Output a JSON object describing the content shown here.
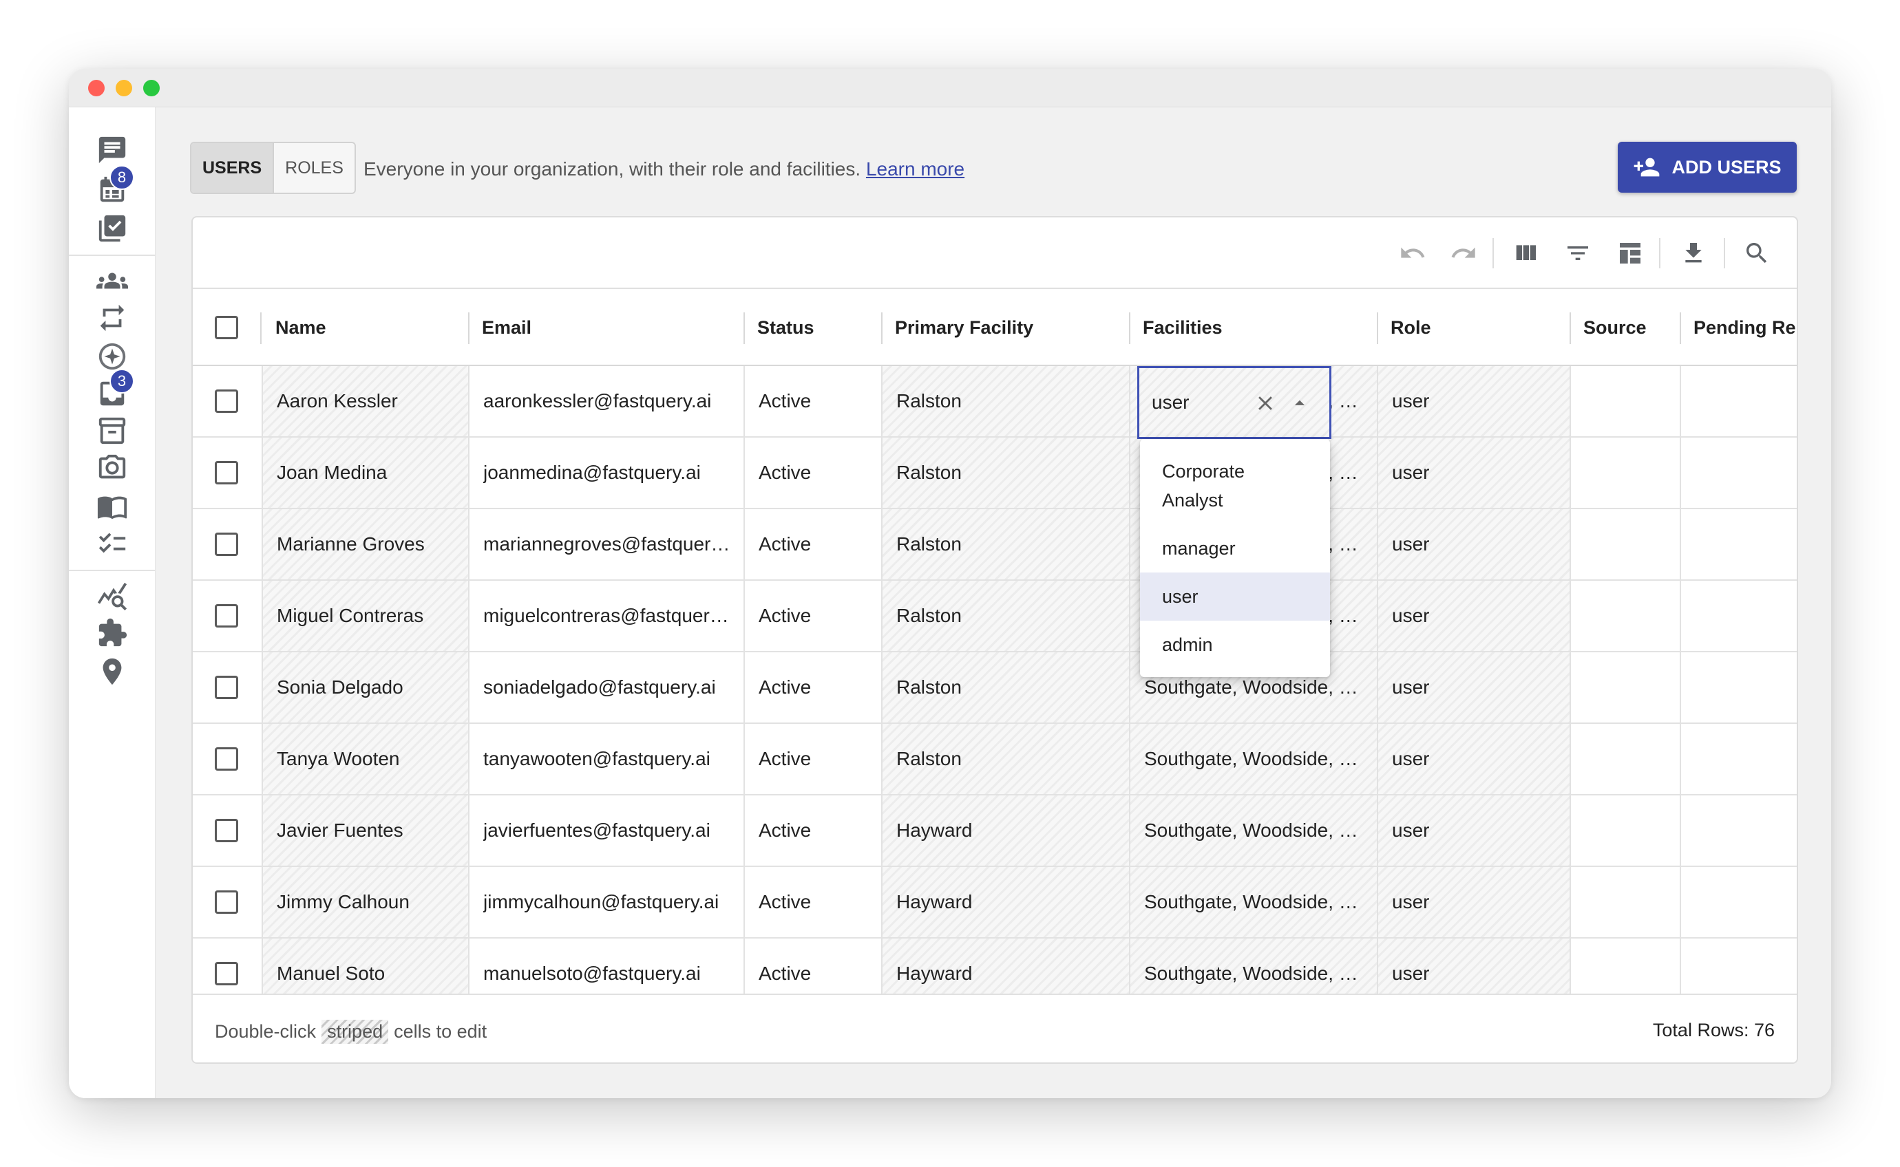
{
  "sidebar": {
    "badges": {
      "calendar": "8",
      "inbox": "3"
    }
  },
  "header": {
    "tabs": [
      "USERS",
      "ROLES"
    ],
    "description": "Everyone in your organization, with their role and facilities.",
    "learn_more": "Learn more",
    "add_button": "ADD USERS"
  },
  "table": {
    "columns": [
      "Name",
      "Email",
      "Status",
      "Primary Facility",
      "Facilities",
      "Role",
      "Source",
      "Pending Rer"
    ],
    "rows": [
      {
        "name": "Aaron Kessler",
        "email": "aaronkessler@fastquery.ai",
        "status": "Active",
        "primary": "Ralston",
        "facilities": "Southgate, Woodside, Ralston",
        "role": "user"
      },
      {
        "name": "Joan Medina",
        "email": "joanmedina@fastquery.ai",
        "status": "Active",
        "primary": "Ralston",
        "facilities": "Southgate, Woodside, Ralston",
        "role": "user"
      },
      {
        "name": "Marianne Groves",
        "email": "mariannegroves@fastquery.ai",
        "status": "Active",
        "primary": "Ralston",
        "facilities": "Southgate, Woodside, Ralston",
        "role": "user"
      },
      {
        "name": "Miguel Contreras",
        "email": "miguelcontreras@fastquery.ai",
        "status": "Active",
        "primary": "Ralston",
        "facilities": "Southgate, Woodside, Ralston",
        "role": "user"
      },
      {
        "name": "Sonia Delgado",
        "email": "soniadelgado@fastquery.ai",
        "status": "Active",
        "primary": "Ralston",
        "facilities": "Southgate, Woodside, Ralston",
        "role": "user"
      },
      {
        "name": "Tanya Wooten",
        "email": "tanyawooten@fastquery.ai",
        "status": "Active",
        "primary": "Ralston",
        "facilities": "Southgate, Woodside, Ralston",
        "role": "user"
      },
      {
        "name": "Javier Fuentes",
        "email": "javierfuentes@fastquery.ai",
        "status": "Active",
        "primary": "Hayward",
        "facilities": "Southgate, Woodside, Ralston",
        "role": "user"
      },
      {
        "name": "Jimmy Calhoun",
        "email": "jimmycalhoun@fastquery.ai",
        "status": "Active",
        "primary": "Hayward",
        "facilities": "Southgate, Woodside, Ralston",
        "role": "user"
      },
      {
        "name": "Manuel Soto",
        "email": "manuelsoto@fastquery.ai",
        "status": "Active",
        "primary": "Hayward",
        "facilities": "Southgate, Woodside, Ralston",
        "role": "user"
      }
    ]
  },
  "role_editor": {
    "value": "user",
    "options": [
      "Corporate Analyst",
      "manager",
      "user",
      "admin"
    ],
    "selected": "user"
  },
  "footer": {
    "hint_prefix": "Double-click",
    "hint_chip": "striped",
    "hint_suffix": "cells to edit",
    "total": "Total Rows: 76"
  },
  "colors": {
    "accent": "#3949ab",
    "badge": "#3949ab"
  }
}
